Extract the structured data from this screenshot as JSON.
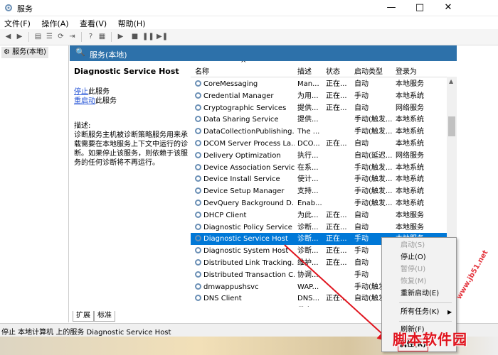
{
  "window": {
    "title": "服务",
    "minimize_glyph": "—",
    "maximize_glyph": "□",
    "close_glyph": "✕"
  },
  "menu": [
    "文件(F)",
    "操作(A)",
    "查看(V)",
    "帮助(H)"
  ],
  "tree": {
    "root_label": "服务(本地)"
  },
  "panel": {
    "header": "服务(本地)"
  },
  "description": {
    "service_title": "Diagnostic Service Host",
    "stop_link": "停止",
    "stop_suffix": "此服务",
    "restart_link": "重启动",
    "restart_suffix": "此服务",
    "label": "描述:",
    "text": "诊断服务主机被诊断策略服务用来承载需要在本地服务上下文中运行的诊断。如果停止该服务，则依赖于该服务的任何诊断将不再运行。"
  },
  "table": {
    "sort_glyph": "^",
    "columns": [
      "名称",
      "描述",
      "状态",
      "启动类型",
      "登录为"
    ],
    "rows": [
      {
        "name": "CoreMessaging",
        "desc": "Man...",
        "status": "正在...",
        "startup": "自动",
        "logon": "本地服务"
      },
      {
        "name": "Credential Manager",
        "desc": "为用...",
        "status": "正在...",
        "startup": "手动",
        "logon": "本地系统"
      },
      {
        "name": "Cryptographic Services",
        "desc": "提供...",
        "status": "正在...",
        "startup": "自动",
        "logon": "网络服务"
      },
      {
        "name": "Data Sharing Service",
        "desc": "提供...",
        "status": "",
        "startup": "手动(触发...",
        "logon": "本地系统"
      },
      {
        "name": "DataCollectionPublishing...",
        "desc": "The ...",
        "status": "",
        "startup": "手动(触发...",
        "logon": "本地系统"
      },
      {
        "name": "DCOM Server Process La...",
        "desc": "DCO...",
        "status": "正在...",
        "startup": "自动",
        "logon": "本地系统"
      },
      {
        "name": "Delivery Optimization",
        "desc": "执行...",
        "status": "",
        "startup": "自动(延迟...",
        "logon": "网络服务"
      },
      {
        "name": "Device Association Service",
        "desc": "在系...",
        "status": "",
        "startup": "手动(触发...",
        "logon": "本地系统"
      },
      {
        "name": "Device Install Service",
        "desc": "使计...",
        "status": "",
        "startup": "手动(触发...",
        "logon": "本地系统"
      },
      {
        "name": "Device Setup Manager",
        "desc": "支持...",
        "status": "",
        "startup": "手动(触发...",
        "logon": "本地系统"
      },
      {
        "name": "DevQuery Background D...",
        "desc": "Enab...",
        "status": "",
        "startup": "手动(触发...",
        "logon": "本地系统"
      },
      {
        "name": "DHCP Client",
        "desc": "为此...",
        "status": "正在...",
        "startup": "自动",
        "logon": "本地服务"
      },
      {
        "name": "Diagnostic Policy Service",
        "desc": "诊断...",
        "status": "正在...",
        "startup": "自动",
        "logon": "本地服务"
      },
      {
        "name": "Diagnostic Service Host",
        "desc": "诊断...",
        "status": "正在...",
        "startup": "手动",
        "logon": "本地服务",
        "selected": true
      },
      {
        "name": "Diagnostic System Host",
        "desc": "诊断...",
        "status": "正在...",
        "startup": "手动",
        "logon": ""
      },
      {
        "name": "Distributed Link Tracking...",
        "desc": "维护...",
        "status": "正在...",
        "startup": "自动",
        "logon": ""
      },
      {
        "name": "Distributed Transaction C...",
        "desc": "协调...",
        "status": "",
        "startup": "手动",
        "logon": ""
      },
      {
        "name": "dmwappushsvc",
        "desc": "WAP...",
        "status": "",
        "startup": "手动(触发...",
        "logon": ""
      },
      {
        "name": "DNS Client",
        "desc": "DNS...",
        "status": "正在...",
        "startup": "自动(触发...",
        "logon": ""
      },
      {
        "name": "Downloaded Maps Man...",
        "desc": "供应...",
        "status": "",
        "startup": "",
        "logon": ""
      }
    ]
  },
  "tabs": [
    "扩展",
    "标准"
  ],
  "status_bar": "停止 本地计算机 上的服务 Diagnostic Service Host",
  "context_menu": [
    {
      "label": "启动(S)",
      "disabled": true
    },
    {
      "label": "停止(O)",
      "disabled": false
    },
    {
      "label": "暂停(U)",
      "disabled": true
    },
    {
      "label": "恢复(M)",
      "disabled": true
    },
    {
      "label": "重新启动(E)",
      "disabled": false
    },
    {
      "label": "所有任务(K)",
      "disabled": false
    },
    {
      "label": "刷新(F)",
      "disabled": false
    },
    {
      "label": "属性(R)",
      "disabled": false
    }
  ],
  "watermark": {
    "brand": "脚本软件园",
    "url": "www.jb51.net"
  },
  "colors": {
    "panel_header": "#2d71aa",
    "selection": "#0078d7",
    "link": "#1f4fd6",
    "watermark": "#e0141e",
    "annotation_arrow": "#e0141e"
  }
}
